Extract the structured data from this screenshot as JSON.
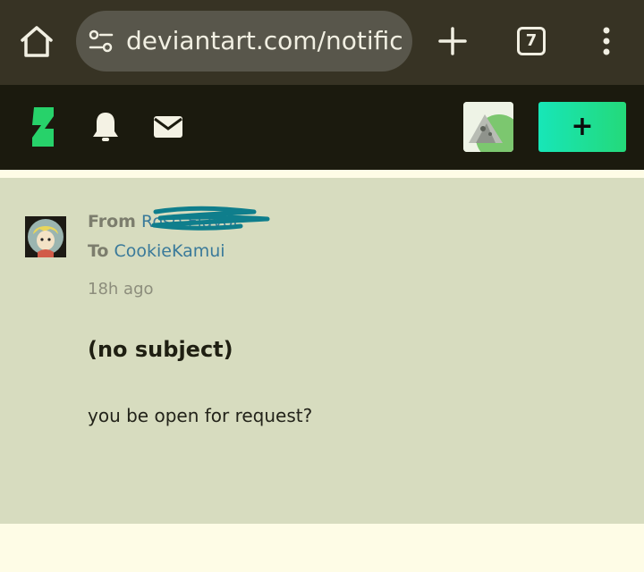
{
  "browser": {
    "url": "deviantart.com/notific",
    "tab_count": "7"
  },
  "header": {
    "submit_label": "+"
  },
  "message": {
    "from_label": "From",
    "from_user": "Rose Flavor",
    "to_label": "To",
    "to_user": "CookieKamui",
    "time": "18h ago",
    "subject": "(no subject)",
    "body": "you be open for request?"
  },
  "icons": {
    "home": "home-icon",
    "site_settings": "tune-icon",
    "new_tab": "plus-icon",
    "menu": "more-vert-icon",
    "logo": "deviantart-logo",
    "notifications": "bell-icon",
    "messages": "mail-icon"
  },
  "colors": {
    "accent_gradient_start": "#17e6b8",
    "accent_gradient_end": "#24d97a",
    "logo_green": "#27d26a",
    "link_blue": "#3a7a9a",
    "redaction_teal": "#0f7e8c"
  }
}
